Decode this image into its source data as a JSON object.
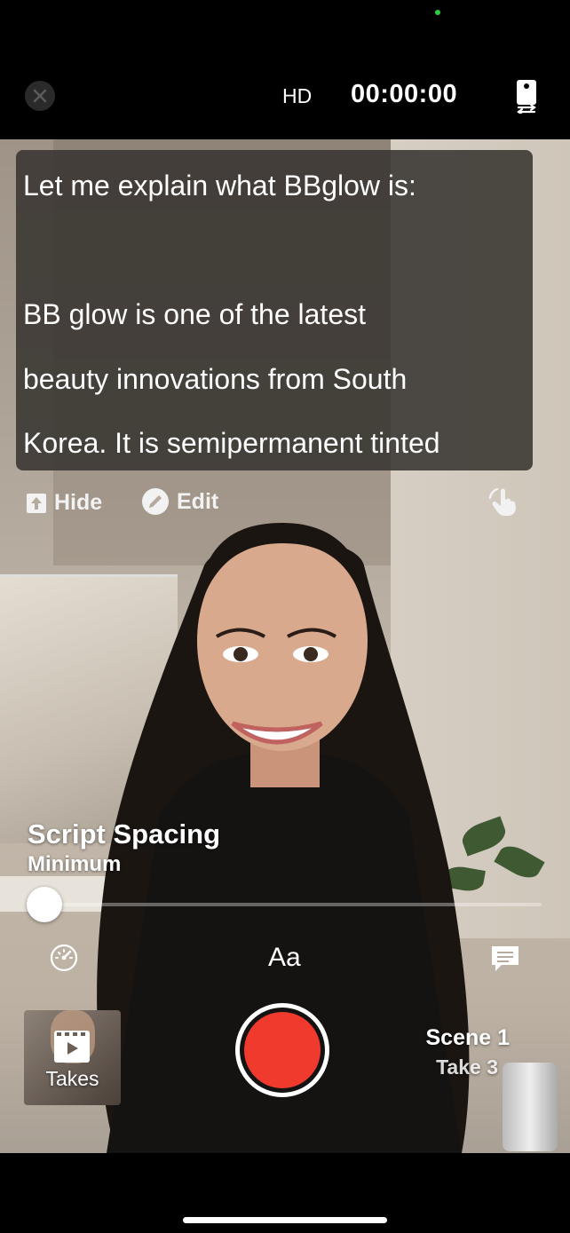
{
  "topbar": {
    "quality": "HD",
    "timer": "00:00:00"
  },
  "script": {
    "lines": [
      "Let me explain what BBglow is:",
      "",
      "BB glow is one of the latest",
      "beauty innovations from South",
      "Korea. It is semipermanent tinted"
    ]
  },
  "controls": {
    "hide_label": "Hide",
    "edit_label": "Edit"
  },
  "spacing": {
    "title": "Script Spacing",
    "value": "Minimum",
    "slider_level": 0.0
  },
  "bottom": {
    "font_label": "Aa",
    "takes_label": "Takes",
    "scene_label": "Scene 1",
    "take_label": "Take 3"
  },
  "colors": {
    "record": "#f03a2d",
    "status_dot": "#2ecc40"
  }
}
